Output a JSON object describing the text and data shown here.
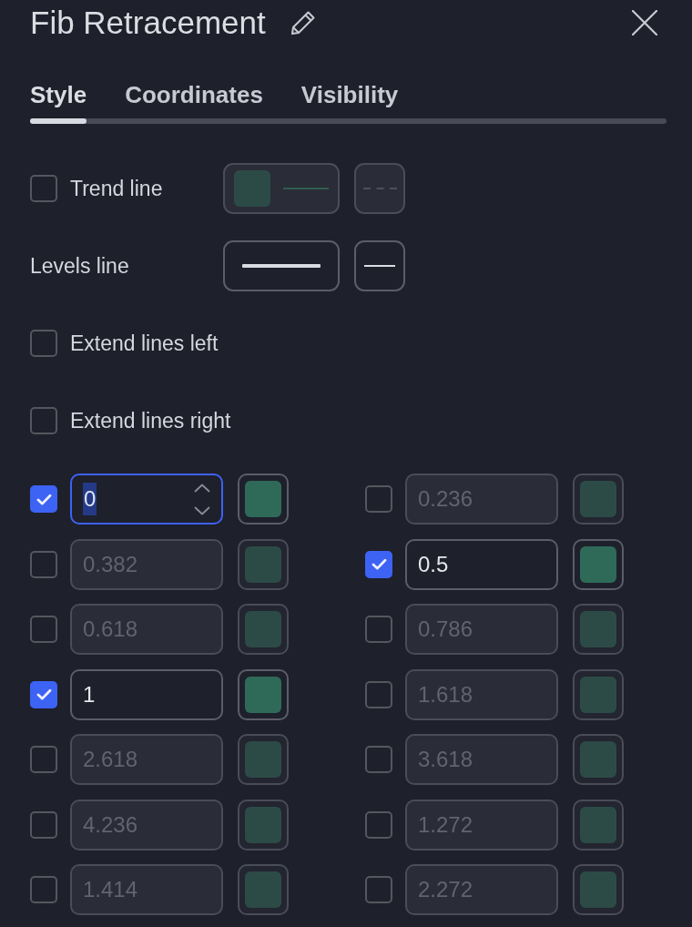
{
  "dialog": {
    "title": "Fib Retracement"
  },
  "tabs": [
    {
      "label": "Style",
      "selected": true
    },
    {
      "label": "Coordinates",
      "selected": false
    },
    {
      "label": "Visibility",
      "selected": false
    }
  ],
  "options": [
    {
      "kind": "trend_line",
      "label": "Trend line",
      "checked": false
    },
    {
      "kind": "levels_line",
      "label": "Levels line"
    },
    {
      "kind": "checkbox",
      "label": "Extend lines left",
      "checked": false
    },
    {
      "kind": "checkbox",
      "label": "Extend lines right",
      "checked": false
    }
  ],
  "levels": [
    {
      "value": "0",
      "checked": true,
      "focused": true
    },
    {
      "value": "0.236",
      "checked": false,
      "focused": false
    },
    {
      "value": "0.382",
      "checked": false,
      "focused": false
    },
    {
      "value": "0.5",
      "checked": true,
      "focused": false
    },
    {
      "value": "0.618",
      "checked": false,
      "focused": false
    },
    {
      "value": "0.786",
      "checked": false,
      "focused": false
    },
    {
      "value": "1",
      "checked": true,
      "focused": false
    },
    {
      "value": "1.618",
      "checked": false,
      "focused": false
    },
    {
      "value": "2.618",
      "checked": false,
      "focused": false
    },
    {
      "value": "3.618",
      "checked": false,
      "focused": false
    },
    {
      "value": "4.236",
      "checked": false,
      "focused": false
    },
    {
      "value": "1.272",
      "checked": false,
      "focused": false
    },
    {
      "value": "1.414",
      "checked": false,
      "focused": false
    },
    {
      "value": "2.272",
      "checked": false,
      "focused": false
    }
  ]
}
